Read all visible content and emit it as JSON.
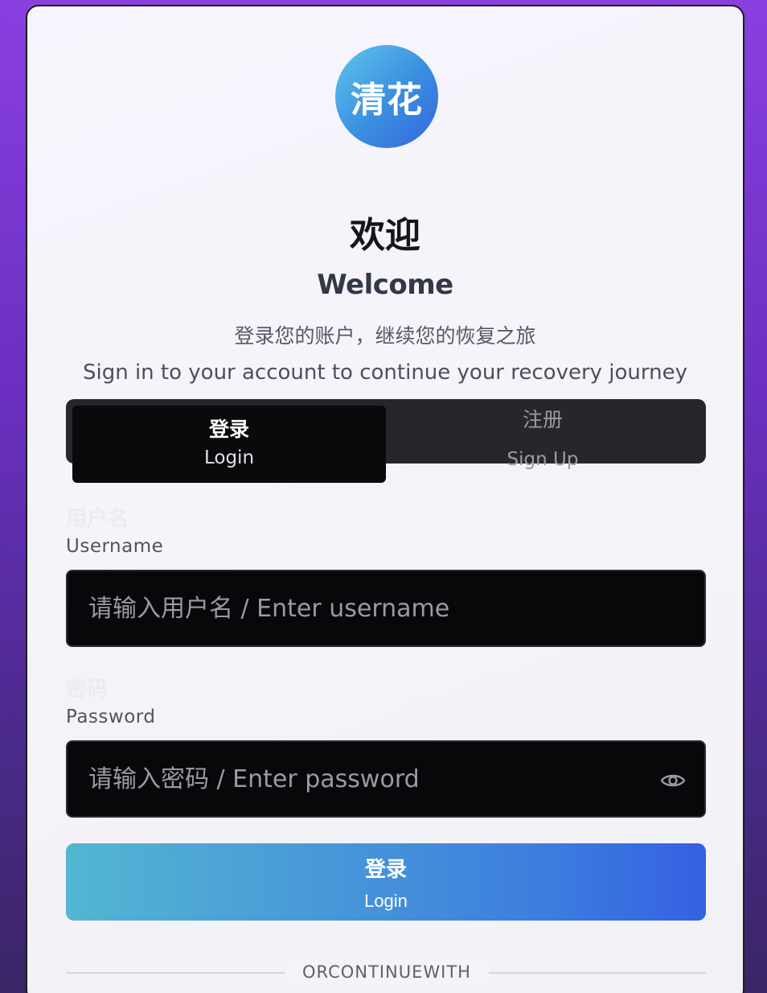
{
  "logo": {
    "text": "清花"
  },
  "heading": {
    "title_cn": "欢迎",
    "title_en": "Welcome",
    "subtitle_cn": "登录您的账户，继续您的恢复之旅",
    "subtitle_en": "Sign in to your account to continue your recovery journey"
  },
  "tabs": [
    {
      "label_cn": "登录",
      "label_en": "Login",
      "active": true
    },
    {
      "label_cn": "注册",
      "label_en": "Sign Up",
      "active": false
    }
  ],
  "form": {
    "username": {
      "label_cn": "用户名",
      "label_en": "Username",
      "placeholder": "请输入用户名 / Enter username",
      "value": ""
    },
    "password": {
      "label_cn": "密码",
      "label_en": "Password",
      "placeholder": "请输入密码 / Enter password",
      "value": "",
      "toggle_icon": "eye-icon"
    },
    "submit": {
      "label_cn": "登录",
      "label_en": "Login"
    }
  },
  "divider": {
    "text": "ORCONTINUEWITH"
  },
  "colors": {
    "background_top": "#8a3fe0",
    "background_bottom": "#3a2566",
    "button_gradient_start": "#53b6d2",
    "button_gradient_end": "#3560e2",
    "input_bg": "#08080b",
    "tab_bar_bg": "#27272b"
  }
}
